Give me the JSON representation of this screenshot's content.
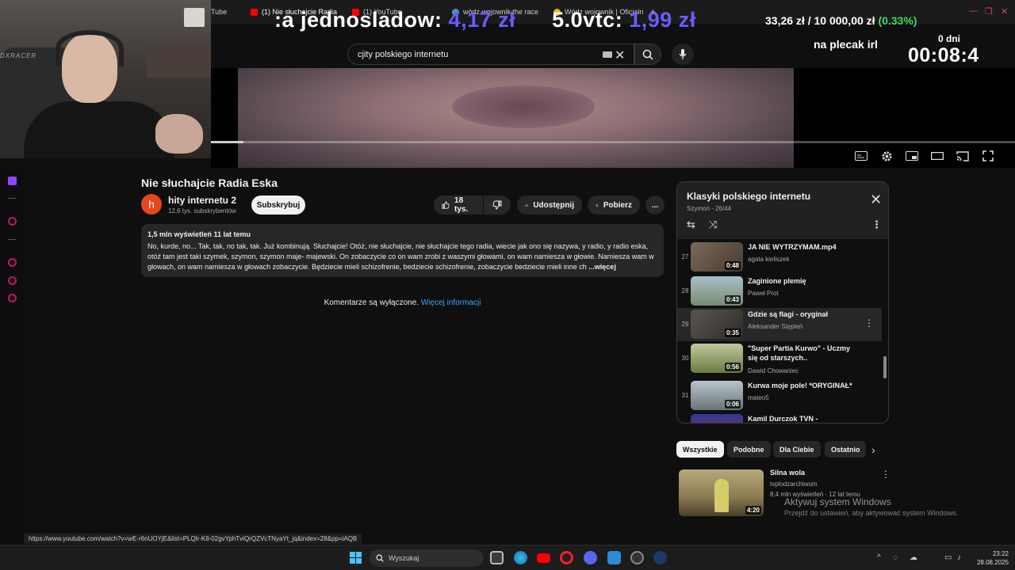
{
  "browser": {
    "tabs": [
      {
        "label": "Tube",
        "favicon_color": "#ff0000"
      },
      {
        "label": "(1) Nie słuchajcie Radia E",
        "favicon_color": "#ff0000",
        "active": true
      },
      {
        "label": "(1) YouTube",
        "favicon_color": "#ff0000"
      },
      {
        "label": "wódz wojownik the race",
        "favicon_color": "#4a90d9"
      },
      {
        "label": "Wódz wojownik | Oficjaln",
        "favicon_color": "#f0b400"
      }
    ],
    "new_tab_label": "+"
  },
  "overlay": {
    "ticker_part1": ":a jednosladow:",
    "ticker_price1": "4,17 zł",
    "ticker_part2": "5.0vtc:",
    "ticker_price2": "1,99 zł",
    "balance_value": "33,26 zł / 10 000,00 zł",
    "balance_pct": "(0.33%)",
    "plecak": "na plecak irl",
    "days": "0 dni",
    "timer": "00:08:4"
  },
  "search": {
    "value": "cjity polskiego internetu"
  },
  "webcam": {
    "chair_brand": "DXRACER"
  },
  "video": {
    "progress_pct": 4,
    "title": "Nie słuchajcie Radia Eska",
    "channel_initial": "h",
    "channel_name": "hity internetu 2",
    "channel_subs": "12,6 tys. subskrybentów",
    "subscribe_label": "Subskrybuj",
    "likes": "18 tys.",
    "share_label": "Udostępnij",
    "download_label": "Pobierz",
    "more_label": "..."
  },
  "description": {
    "meta": "1,5 mln wyświetleń  11 lat temu",
    "text": "No, kurde, no... Tak, tak, no tak, tak. Już kombinują. Słuchajcie! Otóż, nie słuchajcie, nie słuchajcie tego radia, wiecie jak ono się nazywa, y radio, y radio eska, otóż tam jest taki szymek, szymon, szymon maje- majewski. On zobaczycie co on wam zrobi z waszymi głowami, on wam namiesza w głowie. Namiesza wam w głowach, on wam namiesza w głowach zobaczycie. Będziecie mieli schizofrenie, bedziecie schizofrenie, zobaczycie bedziecie mieli inne ch",
    "more": "...więcej"
  },
  "comments": {
    "text": "Komentarze są wyłączone.",
    "link": "Więcej informacji"
  },
  "playlist": {
    "title": "Klasyki polskiego internetu",
    "subtitle": "Szymon - 26/44",
    "items": [
      {
        "num": "27",
        "title": "JA NIE WYTRZYMAM.mp4",
        "author": "agata kieliszek",
        "duration": "0:48",
        "thumb": "#6a5a4a"
      },
      {
        "num": "28",
        "title": "Zaginione plemię",
        "author": "Paweł Prot",
        "duration": "0:43",
        "thumb": "#8fa0a8"
      },
      {
        "num": "29",
        "title": "Gdzie są flagi - oryginał",
        "author": "Aleksander Stępień",
        "duration": "0:35",
        "thumb": "#4e4a44",
        "current": true
      },
      {
        "num": "30",
        "title": "\"Super Partia Kurwo\" - Uczmy się od starszych..",
        "author": "Dawid Chowaniec",
        "duration": "0:56",
        "thumb": "#8a9a5a"
      },
      {
        "num": "31",
        "title": "Kurwa moje pole! *ORYGINAŁ*",
        "author": "mateo5",
        "duration": "0:06",
        "thumb": "#9aa6ae"
      },
      {
        "num": "",
        "title": "Kamil Durczok TVN -",
        "author": "",
        "duration": "",
        "thumb": "#2a3a8a"
      }
    ]
  },
  "chips": [
    "Wszystkie",
    "Podobne",
    "Dla Ciebie",
    "Ostatnio"
  ],
  "recommended": {
    "title": "Silna wola",
    "channel": "tvplodzarchiwum",
    "meta": "8,4 mln wyświetleń · 12 lat temu",
    "duration": "4:20"
  },
  "watermark": {
    "line1": "Aktywuj system Windows",
    "line2": "Przejdź do ustawień, aby aktywować system Windows."
  },
  "status_url": "https://www.youtube.com/watch?v=wE-r6nUOYjE&list=PLQlr-K8-02gvYphTviQrQZVcTNyaYt_jq&index=28&pp=iAQB",
  "taskbar": {
    "search_placeholder": "Wyszukaj",
    "time": "23:22",
    "date": "28.08.2025"
  }
}
